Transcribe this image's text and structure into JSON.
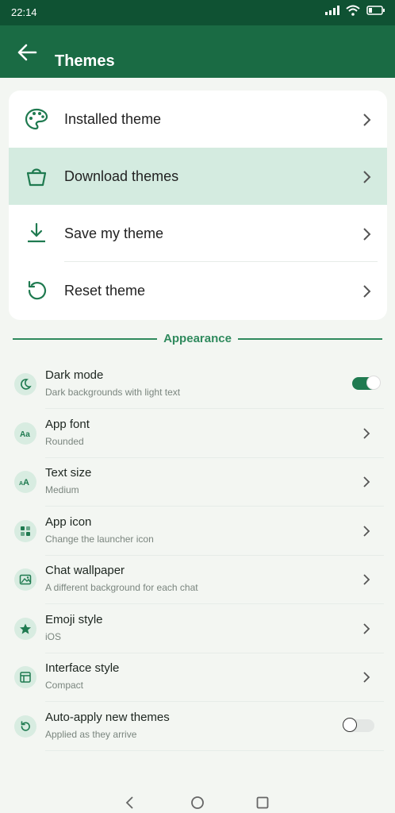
{
  "status": {
    "time": "22:14",
    "icons": [
      "signal-icon",
      "wifi-icon",
      "battery-icon"
    ]
  },
  "header": {
    "title": "Themes"
  },
  "theme_menu": [
    {
      "label": "Installed theme",
      "icon": "palette-icon",
      "selected": false
    },
    {
      "label": "Download themes",
      "icon": "shopping-bag-icon",
      "selected": true
    },
    {
      "label": "Save my theme",
      "icon": "download-icon",
      "selected": false
    },
    {
      "label": "Reset theme",
      "icon": "reset-icon",
      "selected": false
    }
  ],
  "section": {
    "title": "Appearance"
  },
  "settings": [
    {
      "title": "Dark mode",
      "subtitle": "Dark backgrounds with light text",
      "icon": "moon-icon",
      "control": "toggle",
      "on": true
    },
    {
      "title": "App font",
      "subtitle": "Rounded",
      "icon": "font-icon",
      "control": "chevron"
    },
    {
      "title": "Text size",
      "subtitle": "Medium",
      "icon": "text-size-icon",
      "control": "chevron"
    },
    {
      "title": "App icon",
      "subtitle": "Change the launcher icon",
      "icon": "grid-icon",
      "control": "chevron"
    },
    {
      "title": "Chat wallpaper",
      "subtitle": "A different background for each chat",
      "icon": "image-icon",
      "control": "chevron"
    },
    {
      "title": "Emoji style",
      "subtitle": "iOS",
      "icon": "star-icon",
      "control": "chevron"
    },
    {
      "title": "Interface style",
      "subtitle": "Compact",
      "icon": "layout-icon",
      "control": "chevron"
    },
    {
      "title": "Auto-apply new themes",
      "subtitle": "Applied as they arrive",
      "icon": "refresh-icon",
      "control": "toggle",
      "on": false
    }
  ],
  "colors": {
    "statusbar": "#0f5233",
    "appbar": "#1a6b44",
    "accent": "#2f8a5d",
    "selected_row": "#d4ebe0",
    "icon_circle": "#d8ece1"
  }
}
